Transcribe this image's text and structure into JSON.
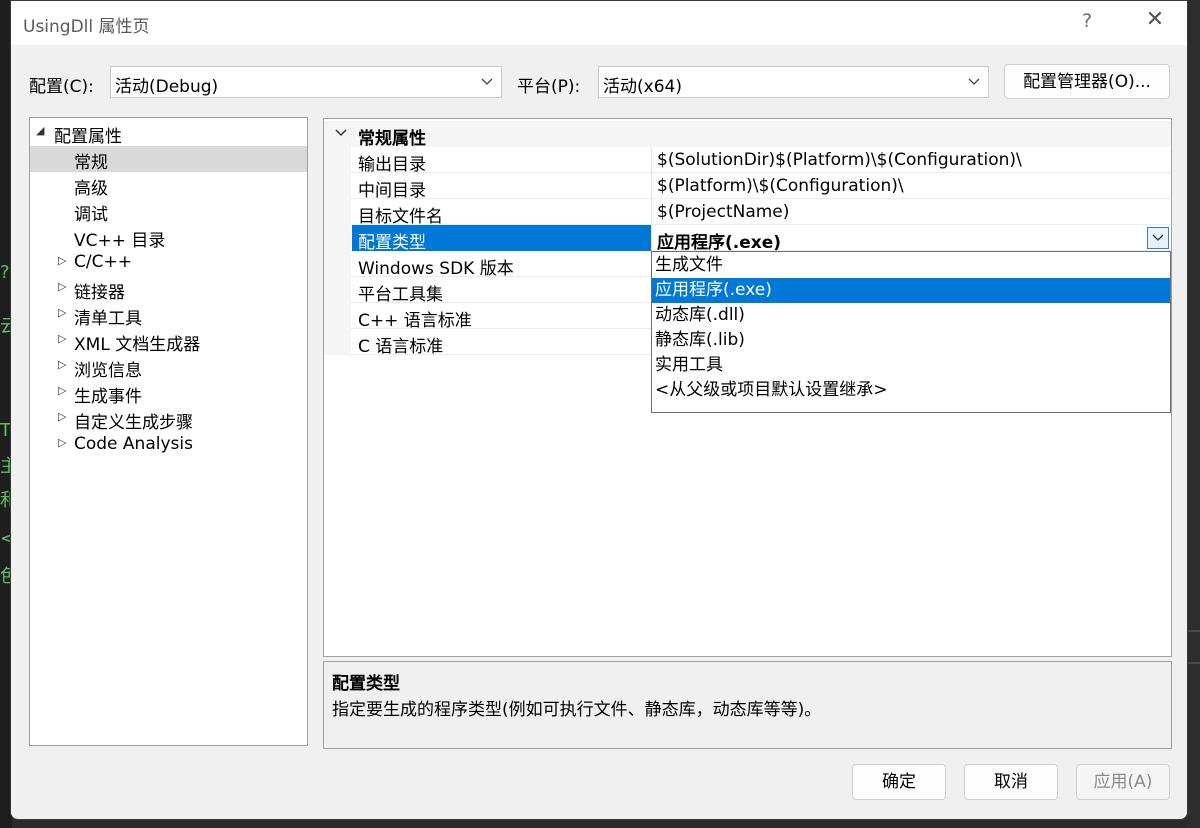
{
  "window": {
    "title": "UsingDll 属性页",
    "help_glyph": "?",
    "close_glyph": "✕"
  },
  "toolbar": {
    "config_label": "配置(C):",
    "config_value": "活动(Debug)",
    "platform_label": "平台(P):",
    "platform_value": "活动(x64)",
    "config_manager_label": "配置管理器(O)..."
  },
  "tree": {
    "root": {
      "label": "配置属性",
      "expanded": true
    },
    "items": [
      {
        "label": "常规",
        "selected": true,
        "expandable": false
      },
      {
        "label": "高级",
        "expandable": false
      },
      {
        "label": "调试",
        "expandable": false
      },
      {
        "label": "VC++ 目录",
        "expandable": false
      },
      {
        "label": "C/C++",
        "expandable": true
      },
      {
        "label": "链接器",
        "expandable": true
      },
      {
        "label": "清单工具",
        "expandable": true
      },
      {
        "label": "XML 文档生成器",
        "expandable": true
      },
      {
        "label": "浏览信息",
        "expandable": true
      },
      {
        "label": "生成事件",
        "expandable": true
      },
      {
        "label": "自定义生成步骤",
        "expandable": true
      },
      {
        "label": "Code Analysis",
        "expandable": true
      }
    ]
  },
  "grid": {
    "category": "常规属性",
    "rows": [
      {
        "name": "输出目录",
        "value": "$(SolutionDir)$(Platform)\\$(Configuration)\\"
      },
      {
        "name": "中间目录",
        "value": "$(Platform)\\$(Configuration)\\"
      },
      {
        "name": "目标文件名",
        "value": "$(ProjectName)"
      },
      {
        "name": "配置类型",
        "value": "应用程序(.exe)",
        "selected": true
      },
      {
        "name": "Windows SDK 版本",
        "value": ""
      },
      {
        "name": "平台工具集",
        "value": ""
      },
      {
        "name": "C++ 语言标准",
        "value": ""
      },
      {
        "name": "C 语言标准",
        "value": ""
      }
    ]
  },
  "dropdown": {
    "options": [
      "生成文件",
      "应用程序(.exe)",
      "动态库(.dll)",
      "静态库(.lib)",
      "实用工具",
      "<从父级或项目默认设置继承>"
    ],
    "selected_index": 1
  },
  "description": {
    "title": "配置类型",
    "text": "指定要生成的程序类型(例如可执行文件、静态库，动态库等等)。"
  },
  "buttons": {
    "ok": "确定",
    "cancel": "取消",
    "apply": "应用(A)"
  },
  "colors": {
    "accent": "#0078d7",
    "dialog_bg": "#f0f0f0",
    "tree_selected": "#d9d9d9"
  }
}
